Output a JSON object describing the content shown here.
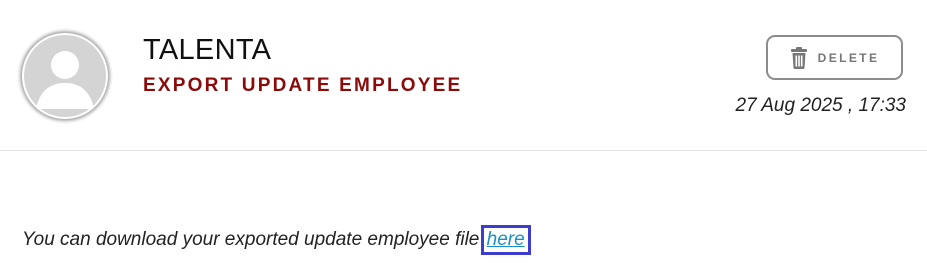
{
  "header": {
    "avatar_icon": "user-placeholder-icon",
    "sender": "TALENTA",
    "subject": "EXPORT UPDATE EMPLOYEE",
    "delete_button": {
      "icon": "trash-icon",
      "label": "DELETE"
    },
    "timestamp": "27 Aug 2025 , 17:33"
  },
  "body": {
    "message": "You can download your exported update employee file ",
    "link_text": "here"
  },
  "colors": {
    "subject": "#8b0a0a",
    "link": "#1a8fc9",
    "highlight_border": "#3c3ccf",
    "button_border": "#8c8c8c"
  }
}
